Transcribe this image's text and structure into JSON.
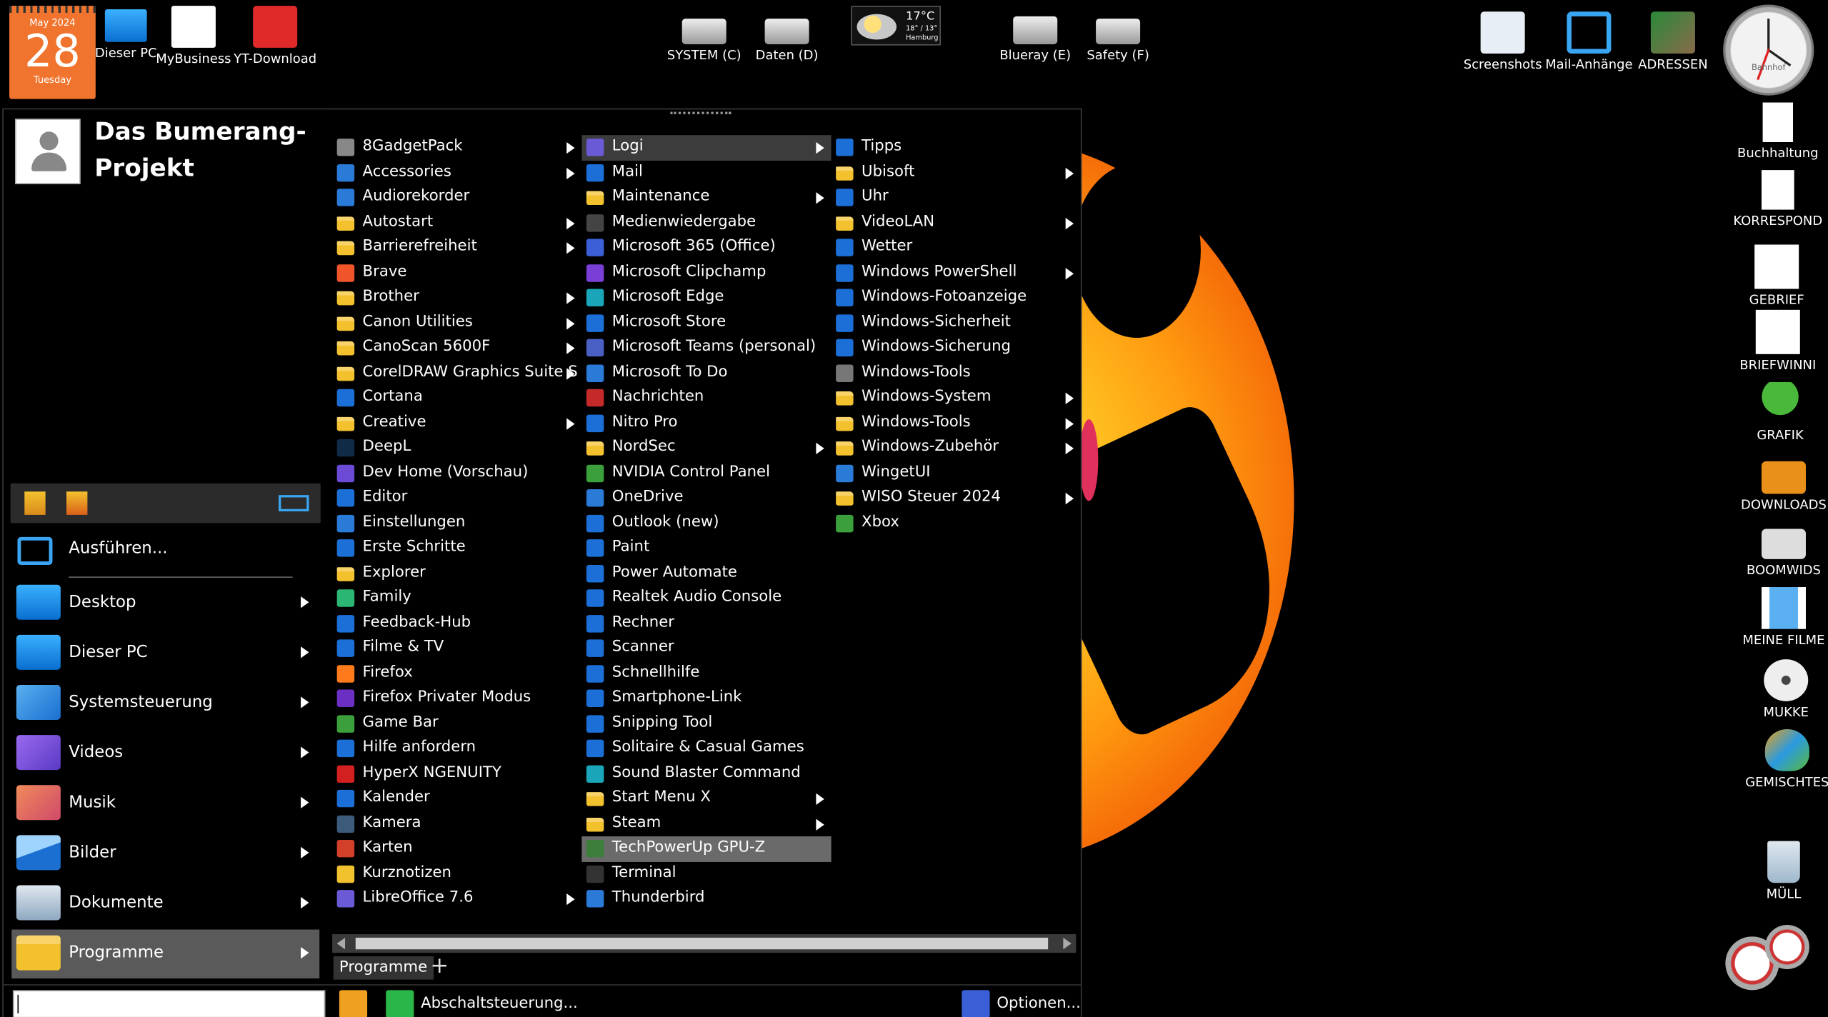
{
  "calendar": {
    "month": "May 2024",
    "day": "28",
    "weekday": "Tuesday"
  },
  "desktop_top": [
    {
      "label": "Dieser PC",
      "icon": "monitor-icon"
    },
    {
      "label": "MyBusiness",
      "icon": "house-icon"
    },
    {
      "label": "YT-Download",
      "icon": "video-download-icon"
    },
    {
      "label": "SYSTEM (C)",
      "icon": "drive-icon"
    },
    {
      "label": "Daten (D)",
      "icon": "drive-icon"
    },
    {
      "label": "Blueray (E)",
      "icon": "bluray-drive-icon"
    },
    {
      "label": "Safety (F)",
      "icon": "drive-icon"
    },
    {
      "label": "Screenshots",
      "icon": "screenshot-icon"
    },
    {
      "label": "Mail-Anhänge",
      "icon": "mail-attachment-icon"
    },
    {
      "label": "ADRESSEN",
      "icon": "address-icon"
    }
  ],
  "weather": {
    "temp": "17°C",
    "range": "18° / 13°",
    "city": "Hamburg"
  },
  "clock": {
    "label": "Bahnhof"
  },
  "desktop_right": [
    {
      "label": "Buchhaltung"
    },
    {
      "label": "KORRESPOND"
    },
    {
      "label": "GEBRIEF"
    },
    {
      "label": "BRIEFWINNI"
    },
    {
      "label": "GRAFIK"
    },
    {
      "label": "DOWNLOADS"
    },
    {
      "label": "BOOMWIDS"
    },
    {
      "label": "MEINE FILME"
    },
    {
      "label": "MUKKE"
    },
    {
      "label": "GEMISCHTES"
    },
    {
      "label": "MÜLL"
    }
  ],
  "user": {
    "name": "Das Bumerang-Projekt"
  },
  "left_panel": {
    "run": "Ausführen...",
    "items": [
      {
        "label": "Desktop"
      },
      {
        "label": "Dieser PC"
      },
      {
        "label": "Systemsteuerung"
      },
      {
        "label": "Videos"
      },
      {
        "label": "Musik"
      },
      {
        "label": "Bilder"
      },
      {
        "label": "Dokumente"
      },
      {
        "label": "Programme"
      }
    ]
  },
  "programs": {
    "col1": [
      {
        "label": "8GadgetPack",
        "sub": true,
        "color": "#888"
      },
      {
        "label": "Accessories",
        "sub": true,
        "color": "#2a7ad8"
      },
      {
        "label": "Audiorekorder",
        "sub": false,
        "color": "#2a7ad8"
      },
      {
        "label": "Autostart",
        "sub": true,
        "folder": true
      },
      {
        "label": "Barrierefreiheit",
        "sub": true,
        "folder": true
      },
      {
        "label": "Brave",
        "sub": false,
        "color": "#f0552a"
      },
      {
        "label": "Brother",
        "sub": true,
        "folder": true
      },
      {
        "label": "Canon Utilities",
        "sub": true,
        "folder": true
      },
      {
        "label": "CanoScan 5600F",
        "sub": true,
        "folder": true
      },
      {
        "label": "CorelDRAW Graphics Suite S",
        "sub": true,
        "folder": true
      },
      {
        "label": "Cortana",
        "sub": false,
        "color": "#1b6fd6"
      },
      {
        "label": "Creative",
        "sub": true,
        "folder": true
      },
      {
        "label": "DeepL",
        "sub": false,
        "color": "#0f2b46"
      },
      {
        "label": "Dev Home (Vorschau)",
        "sub": false,
        "color": "#6b4bd6"
      },
      {
        "label": "Editor",
        "sub": false,
        "color": "#1b6fd6"
      },
      {
        "label": "Einstellungen",
        "sub": false,
        "color": "#2a7ad8"
      },
      {
        "label": "Erste Schritte",
        "sub": false,
        "color": "#1b6fd6"
      },
      {
        "label": "Explorer",
        "sub": false,
        "folder": true
      },
      {
        "label": "Family",
        "sub": false,
        "color": "#2bb673"
      },
      {
        "label": "Feedback-Hub",
        "sub": false,
        "color": "#1b6fd6"
      },
      {
        "label": "Filme & TV",
        "sub": false,
        "color": "#1b6fd6"
      },
      {
        "label": "Firefox",
        "sub": false,
        "color": "#ff7a1a"
      },
      {
        "label": "Firefox Privater Modus",
        "sub": false,
        "color": "#6b2fc4"
      },
      {
        "label": "Game Bar",
        "sub": false,
        "color": "#3b9f3b"
      },
      {
        "label": "Hilfe anfordern",
        "sub": false,
        "color": "#1b6fd6"
      },
      {
        "label": "HyperX NGENUITY",
        "sub": false,
        "color": "#d22020"
      },
      {
        "label": "Kalender",
        "sub": false,
        "color": "#1b6fd6"
      },
      {
        "label": "Kamera",
        "sub": false,
        "color": "#3c5a7a"
      },
      {
        "label": "Karten",
        "sub": false,
        "color": "#d2402a"
      },
      {
        "label": "Kurznotizen",
        "sub": false,
        "color": "#f2c12e"
      },
      {
        "label": "LibreOffice 7.6",
        "sub": true,
        "color": "#6a5ad6"
      }
    ],
    "col2": [
      {
        "label": "Logi",
        "sub": true,
        "color": "#6a5ad6",
        "hl": true
      },
      {
        "label": "Mail",
        "sub": false,
        "color": "#1b6fd6"
      },
      {
        "label": "Maintenance",
        "sub": true,
        "folder": true
      },
      {
        "label": "Medienwiedergabe",
        "sub": false,
        "color": "#444"
      },
      {
        "label": "Microsoft 365 (Office)",
        "sub": false,
        "color": "#3a5fd6"
      },
      {
        "label": "Microsoft Clipchamp",
        "sub": false,
        "color": "#7a3fd6"
      },
      {
        "label": "Microsoft Edge",
        "sub": false,
        "color": "#1aa6b8"
      },
      {
        "label": "Microsoft Store",
        "sub": false,
        "color": "#1b6fd6"
      },
      {
        "label": "Microsoft Teams (personal)",
        "sub": false,
        "color": "#4a5fc4"
      },
      {
        "label": "Microsoft To Do",
        "sub": false,
        "color": "#2a7ad8"
      },
      {
        "label": "Nachrichten",
        "sub": false,
        "color": "#c42a2a"
      },
      {
        "label": "Nitro Pro",
        "sub": false,
        "color": "#1b6fd6"
      },
      {
        "label": "NordSec",
        "sub": true,
        "folder": true
      },
      {
        "label": "NVIDIA Control Panel",
        "sub": false,
        "color": "#3b9f3b"
      },
      {
        "label": "OneDrive",
        "sub": false,
        "color": "#2a7ad8"
      },
      {
        "label": "Outlook (new)",
        "sub": false,
        "color": "#1b6fd6"
      },
      {
        "label": "Paint",
        "sub": false,
        "color": "#1b6fd6"
      },
      {
        "label": "Power Automate",
        "sub": false,
        "color": "#1b6fd6"
      },
      {
        "label": "Realtek Audio Console",
        "sub": false,
        "color": "#1b6fd6"
      },
      {
        "label": "Rechner",
        "sub": false,
        "color": "#1b6fd6"
      },
      {
        "label": "Scanner",
        "sub": false,
        "color": "#1b6fd6"
      },
      {
        "label": "Schnellhilfe",
        "sub": false,
        "color": "#1b6fd6"
      },
      {
        "label": "Smartphone-Link",
        "sub": false,
        "color": "#1b6fd6"
      },
      {
        "label": "Snipping Tool",
        "sub": false,
        "color": "#1b6fd6"
      },
      {
        "label": "Solitaire & Casual Games",
        "sub": false,
        "color": "#1b6fd6"
      },
      {
        "label": "Sound Blaster Command",
        "sub": false,
        "color": "#1aa6b8"
      },
      {
        "label": "Start Menu X",
        "sub": true,
        "folder": true
      },
      {
        "label": "Steam",
        "sub": true,
        "folder": true
      },
      {
        "label": "TechPowerUp GPU-Z",
        "sub": false,
        "color": "#3b7f3b",
        "hl2": true
      },
      {
        "label": "Terminal",
        "sub": false,
        "color": "#333"
      },
      {
        "label": "Thunderbird",
        "sub": false,
        "color": "#2a7ad8"
      }
    ],
    "col3": [
      {
        "label": "Tipps",
        "sub": false,
        "color": "#1b6fd6"
      },
      {
        "label": "Ubisoft",
        "sub": true,
        "folder": true
      },
      {
        "label": "Uhr",
        "sub": false,
        "color": "#1b6fd6"
      },
      {
        "label": "VideoLAN",
        "sub": true,
        "folder": true
      },
      {
        "label": "Wetter",
        "sub": false,
        "color": "#1b6fd6"
      },
      {
        "label": "Windows PowerShell",
        "sub": true,
        "color": "#1b6fd6"
      },
      {
        "label": "Windows-Fotoanzeige",
        "sub": false,
        "color": "#1b6fd6"
      },
      {
        "label": "Windows-Sicherheit",
        "sub": false,
        "color": "#1b6fd6"
      },
      {
        "label": "Windows-Sicherung",
        "sub": false,
        "color": "#1b6fd6"
      },
      {
        "label": "Windows-Tools",
        "sub": false,
        "color": "#777"
      },
      {
        "label": "Windows-System",
        "sub": true,
        "folder": true
      },
      {
        "label": "Windows-Tools",
        "sub": true,
        "folder": true
      },
      {
        "label": "Windows-Zubehör",
        "sub": true,
        "folder": true
      },
      {
        "label": "WingetUI",
        "sub": false,
        "color": "#2a7ad8"
      },
      {
        "label": "WISO Steuer 2024",
        "sub": true,
        "folder": true
      },
      {
        "label": "Xbox",
        "sub": false,
        "color": "#3b9f3b"
      }
    ]
  },
  "tab": {
    "label": "Programme"
  },
  "bottom": {
    "shutdown": "Abschaltsteuerung...",
    "options": "Optionen..."
  }
}
